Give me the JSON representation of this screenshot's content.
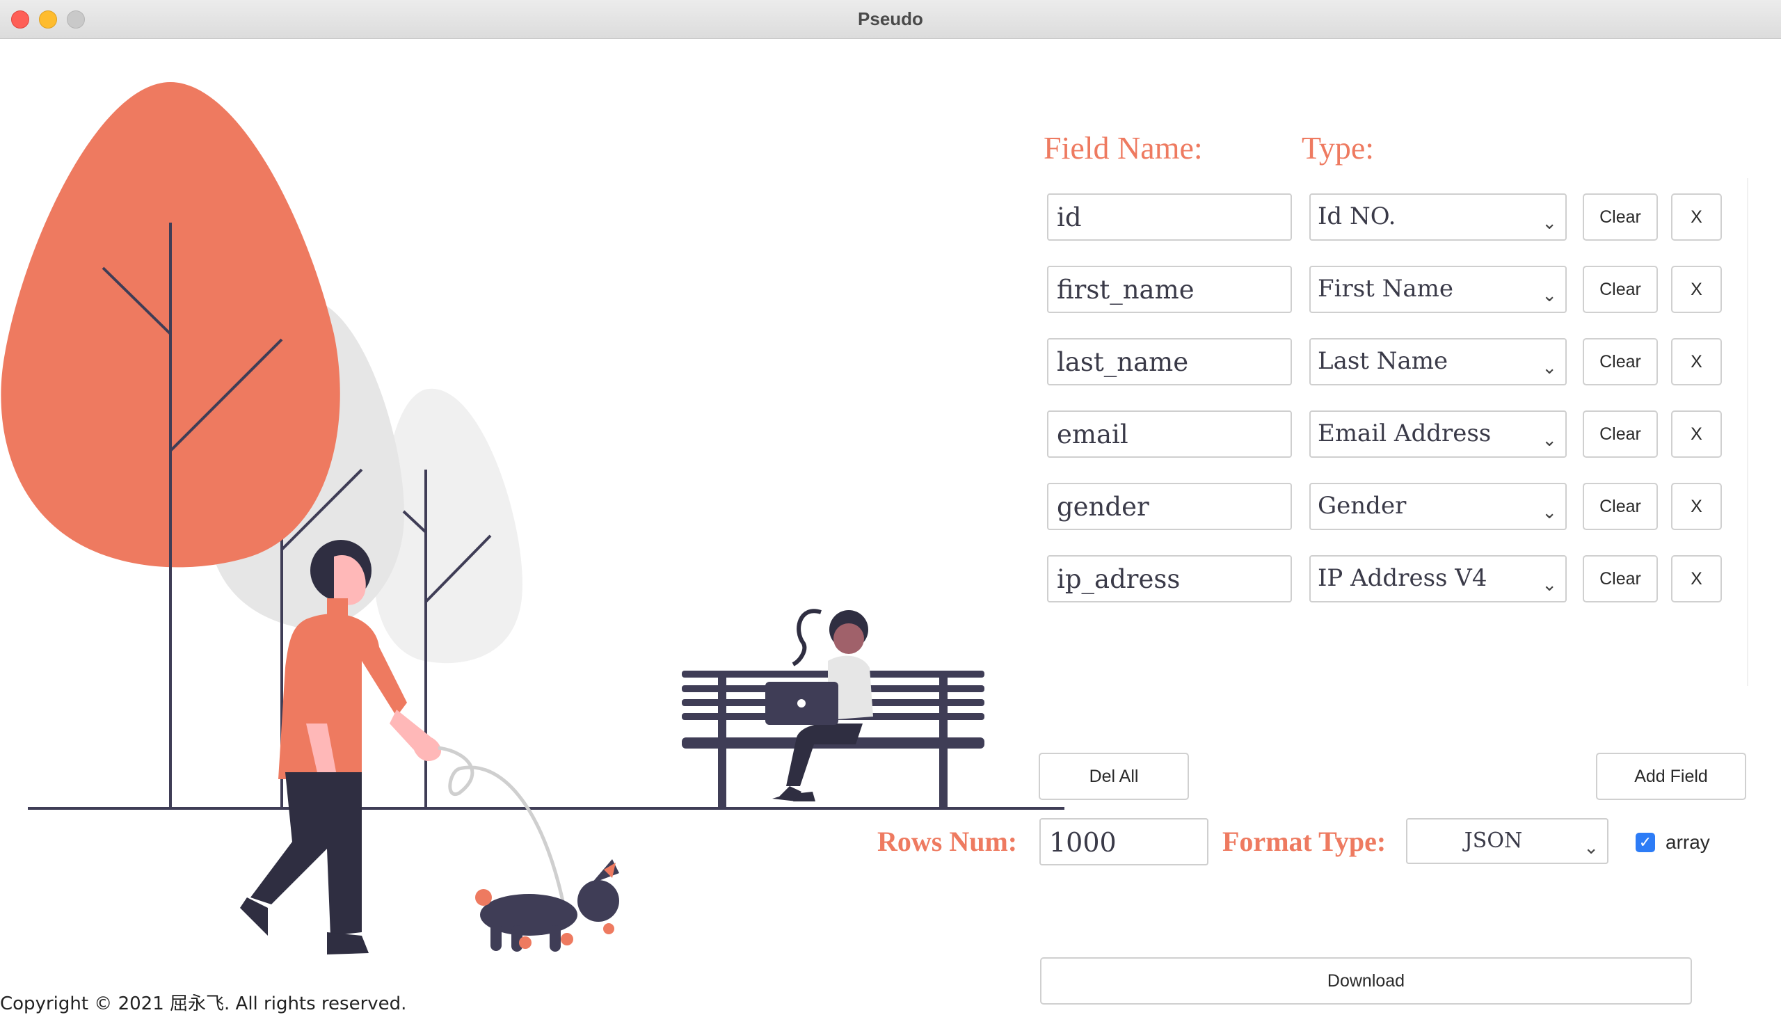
{
  "window": {
    "title": "Pseudo"
  },
  "headings": {
    "field_name": "Field Name:",
    "type": "Type:"
  },
  "fields": [
    {
      "name": "id",
      "type": "Id NO.",
      "clear": "Clear",
      "remove": "X"
    },
    {
      "name": "first_name",
      "type": "First Name",
      "clear": "Clear",
      "remove": "X"
    },
    {
      "name": "last_name",
      "type": "Last Name",
      "clear": "Clear",
      "remove": "X"
    },
    {
      "name": "email",
      "type": "Email Address",
      "clear": "Clear",
      "remove": "X"
    },
    {
      "name": "gender",
      "type": "Gender",
      "clear": "Clear",
      "remove": "X"
    },
    {
      "name": "ip_adress",
      "type": "IP Address V4",
      "clear": "Clear",
      "remove": "X"
    }
  ],
  "actions": {
    "del_all": "Del All",
    "add_field": "Add Field",
    "download": "Download"
  },
  "options": {
    "rows_label": "Rows Num:",
    "rows_value": "1000",
    "format_label": "Format Type:",
    "format_value": "JSON",
    "array_label": "array",
    "array_checked": true
  },
  "footer": {
    "copyright": "Copyright © 2021 屈永飞. All rights reserved."
  },
  "colors": {
    "accent": "#ee7a60",
    "dark": "#3f3d56",
    "checkbox": "#2d7cf6"
  },
  "icons": {
    "select_chevron": "chevron-down-icon",
    "checkbox": "checkmark-icon"
  }
}
